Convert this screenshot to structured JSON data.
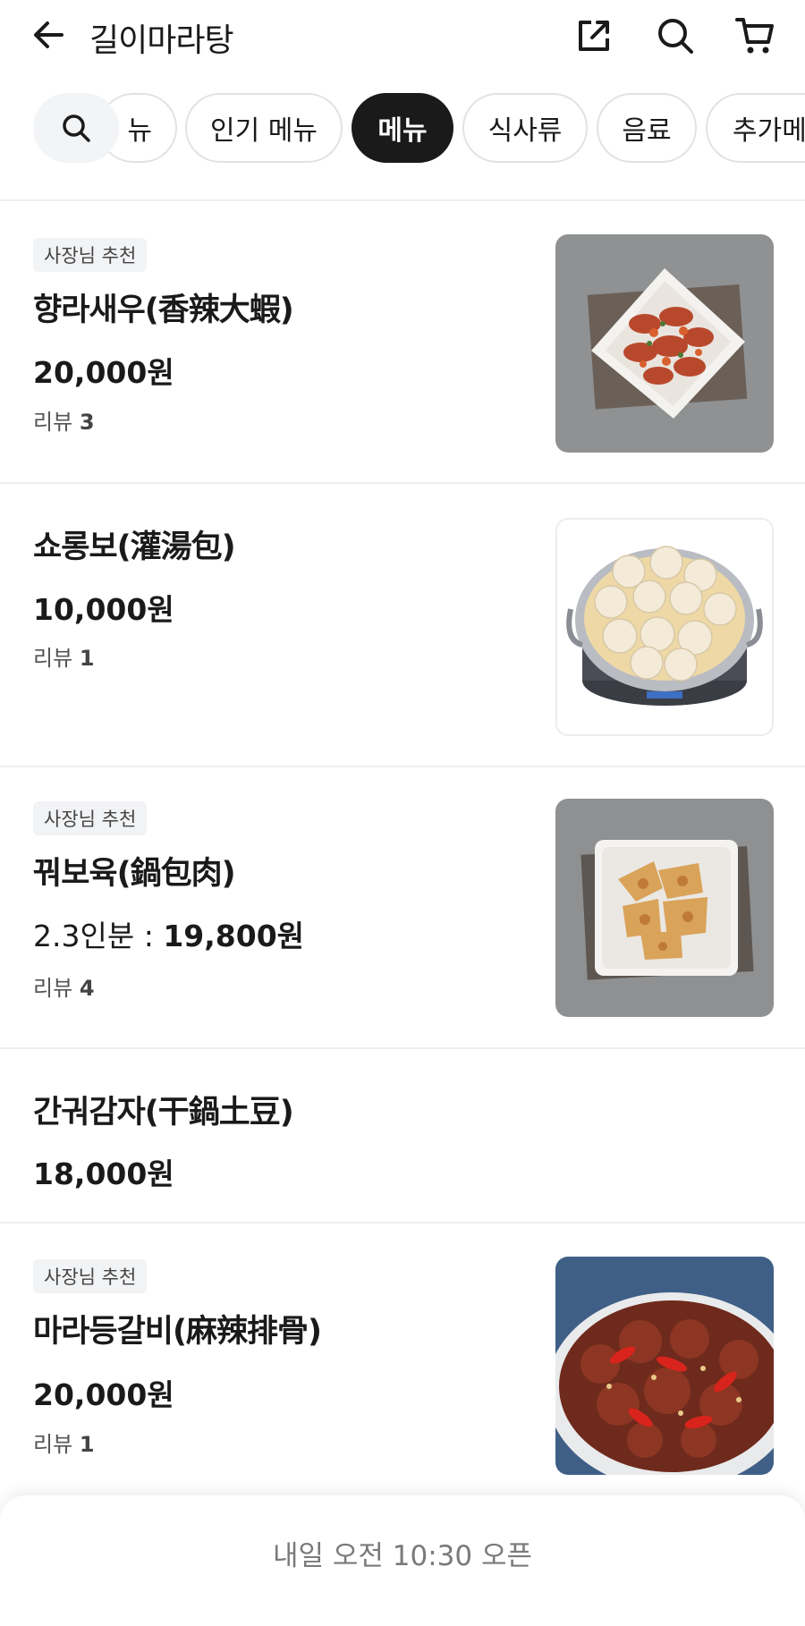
{
  "header": {
    "store_name": "길이마라탕",
    "back_icon": "arrow-left-icon",
    "share_icon": "share-icon",
    "search_icon": "search-icon",
    "cart_icon": "cart-icon"
  },
  "tabs": {
    "items": [
      {
        "label": "뉴"
      },
      {
        "label": "인기 메뉴"
      },
      {
        "label": "메뉴"
      },
      {
        "label": "식사류"
      },
      {
        "label": "음료"
      },
      {
        "label": "추가메"
      }
    ],
    "active_index": 2
  },
  "menu": {
    "items": [
      {
        "badge": "사장님 추천",
        "name": "향라새우(香辣大蝦)",
        "price": "20,000원",
        "review_label": "리뷰",
        "review_count": "3"
      },
      {
        "name": "쇼롱보(灌湯包)",
        "price": "10,000원",
        "review_label": "리뷰",
        "review_count": "1"
      },
      {
        "badge": "사장님 추천",
        "name": "꿔보육(鍋包肉)",
        "portion": "2.3인분 : ",
        "price": "19,800원",
        "review_label": "리뷰",
        "review_count": "4"
      },
      {
        "name": "간궈감자(干鍋土豆)",
        "price": "18,000원"
      },
      {
        "badge": "사장님 추천",
        "name": "마라등갈비(麻辣排骨)",
        "price": "20,000원",
        "review_label": "리뷰",
        "review_count": "1"
      }
    ]
  },
  "bottom_bar": {
    "open_notice": "내일 오전 10:30 오픈"
  },
  "colors": {
    "active_tab": "#1a1a1a",
    "badge_bg": "#f2f3f5",
    "divider": "#eeeeee"
  }
}
